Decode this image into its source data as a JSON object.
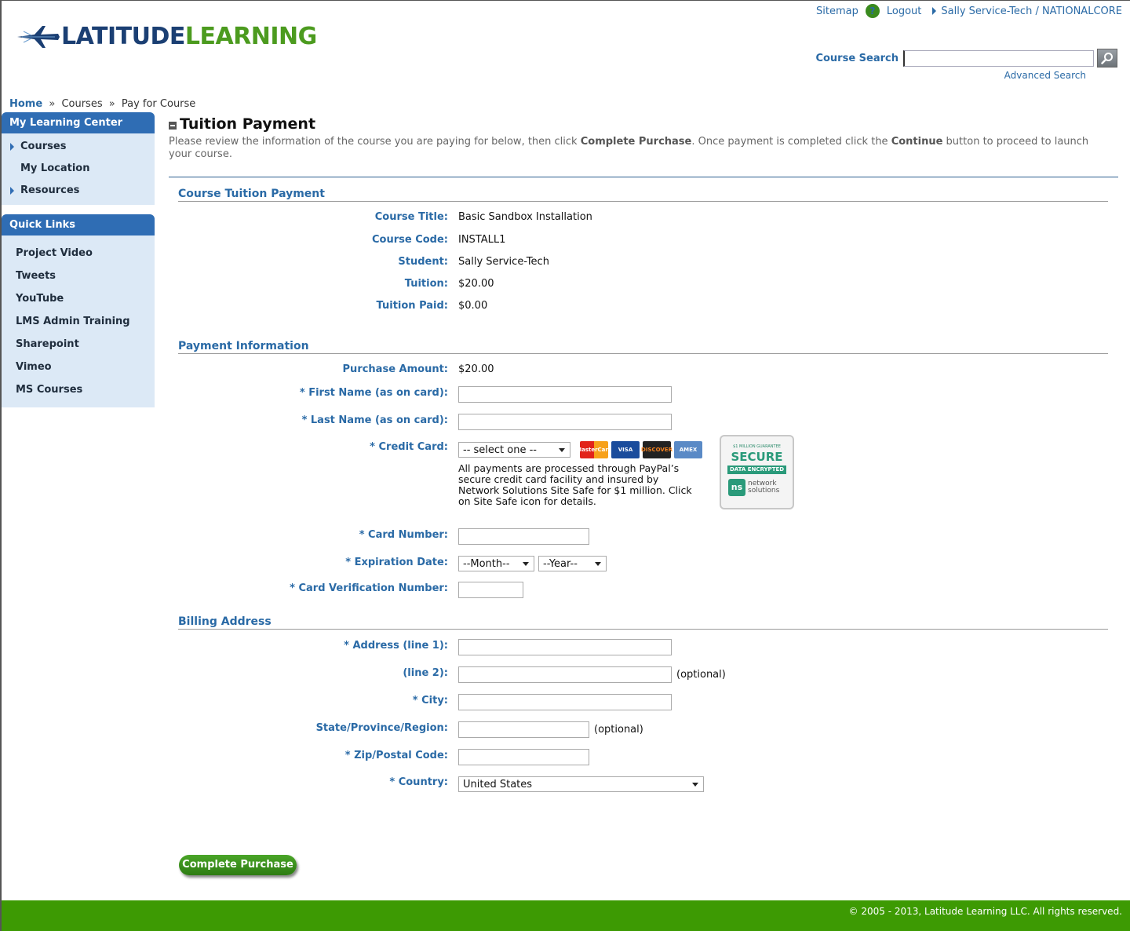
{
  "header": {
    "logo_part1": "LATITUDE",
    "logo_part2": "LEARNING",
    "sitemap": "Sitemap",
    "help": "?",
    "logout": "Logout",
    "user": "Sally Service-Tech / NATIONALCORE",
    "search_label": "Course Search",
    "search_value": "",
    "advanced_search": "Advanced Search"
  },
  "breadcrumb": {
    "home": "Home",
    "sep1": "»",
    "courses": "Courses",
    "sep2": "»",
    "current": "Pay for Course"
  },
  "sidebar": {
    "learning_center_title": "My Learning Center",
    "items": [
      "Courses",
      "My Location",
      "Resources"
    ],
    "quick_links_title": "Quick Links",
    "quick_links": [
      "Project Video",
      "Tweets",
      "YouTube",
      "LMS Admin Training",
      "Sharepoint",
      "Vimeo",
      "MS Courses"
    ]
  },
  "main": {
    "title": "Tuition Payment",
    "intro_1": "Please review the information of the course you are paying for below, then click ",
    "intro_b1": "Complete Purchase",
    "intro_2": ". Once payment is completed click the ",
    "intro_b2": "Continue",
    "intro_3": " button to proceed to launch your course."
  },
  "course_section": {
    "title": "Course Tuition Payment",
    "course_title_label": "Course Title:",
    "course_title": "Basic Sandbox Installation",
    "course_code_label": "Course Code:",
    "course_code": "INSTALL1",
    "student_label": "Student:",
    "student": "Sally Service-Tech",
    "tuition_label": "Tuition:",
    "tuition": "$20.00",
    "tuition_paid_label": "Tuition Paid:",
    "tuition_paid": "$0.00"
  },
  "payment_section": {
    "title": "Payment Information",
    "purchase_amount_label": "Purchase Amount:",
    "purchase_amount": "$20.00",
    "first_name_label": "* First Name (as on card):",
    "first_name": "",
    "last_name_label": "* Last Name (as on card):",
    "last_name": "",
    "credit_card_label": "* Credit Card:",
    "credit_card_selected": "-- select one --",
    "card_mastercard": "MasterCard",
    "card_visa": "VISA",
    "card_discover": "DISCOVER",
    "card_amex": "AMEX",
    "cc_note": "All payments are processed through PayPal’s secure credit card facility and insured by Network Solutions Site Safe for $1 million. Click on Site Safe icon for details.",
    "badge_top": "$1 MILLION GUARANTEE",
    "badge_secure": "SECURE",
    "badge_encrypted": "DATA ENCRYPTED",
    "badge_ns": "ns",
    "badge_network": "network",
    "badge_solutions": "solutions",
    "card_number_label": "* Card Number:",
    "card_number": "",
    "expiration_label": "* Expiration Date:",
    "month_selected": "--Month--",
    "year_selected": "--Year--",
    "cvv_label": "* Card Verification Number:",
    "cvv": ""
  },
  "billing_section": {
    "title": "Billing Address",
    "address1_label": "* Address (line 1):",
    "address2_label": "(line 2):",
    "optional": "(optional)",
    "city_label": "* City:",
    "state_label": "State/Province/Region:",
    "zip_label": "* Zip/Postal Code:",
    "country_label": "* Country:",
    "country_selected": "United States"
  },
  "actions": {
    "complete_purchase": "Complete Purchase"
  },
  "footer": {
    "copyright": "© 2005 - 2013, Latitude Learning LLC. All rights reserved."
  },
  "colors": {
    "brand_blue": "#2a6aa6",
    "brand_green": "#3d9a03",
    "sidebar_header": "#2f6db4",
    "sidebar_bg": "#dce9f6"
  }
}
